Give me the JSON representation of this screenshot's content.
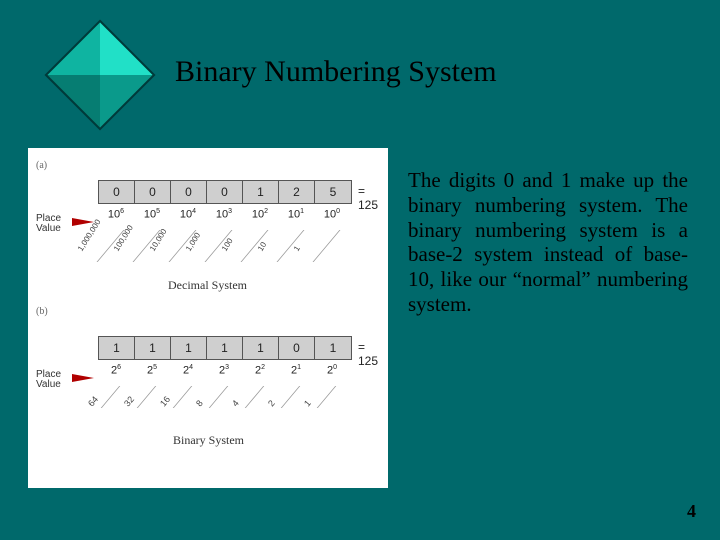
{
  "title": "Binary Numbering System",
  "body": "The digits 0 and 1 make up the binary numbering system. The binary numbering system is a base-2 system instead of base-10, like our “normal” numbering system.",
  "page_number": "4",
  "figure": {
    "part_a_label": "(a)",
    "part_b_label": "(b)",
    "decimal": {
      "digits": [
        "0",
        "0",
        "0",
        "0",
        "1",
        "2",
        "5"
      ],
      "result": "= 125",
      "place_value_label": "Place Value",
      "powers": [
        "10",
        "10",
        "10",
        "10",
        "10",
        "10",
        "10"
      ],
      "exponents": [
        "6",
        "5",
        "4",
        "3",
        "2",
        "1",
        "0"
      ],
      "place_values": [
        "1,000,000",
        "100,000",
        "10,000",
        "1,000",
        "100",
        "10",
        "1"
      ],
      "caption": "Decimal System"
    },
    "binary": {
      "digits": [
        "1",
        "1",
        "1",
        "1",
        "1",
        "0",
        "1"
      ],
      "result": "= 125",
      "place_value_label": "Place Value",
      "powers": [
        "2",
        "2",
        "2",
        "2",
        "2",
        "2",
        "2"
      ],
      "exponents": [
        "6",
        "5",
        "4",
        "3",
        "2",
        "1",
        "0"
      ],
      "place_values": [
        "64",
        "32",
        "16",
        "8",
        "4",
        "2",
        "1"
      ],
      "caption": "Binary System"
    }
  },
  "colors": {
    "background": "#00696b",
    "diamond_fill": "#16c9b4",
    "diamond_edge": "#003a3a",
    "arrow": "#b00000"
  }
}
